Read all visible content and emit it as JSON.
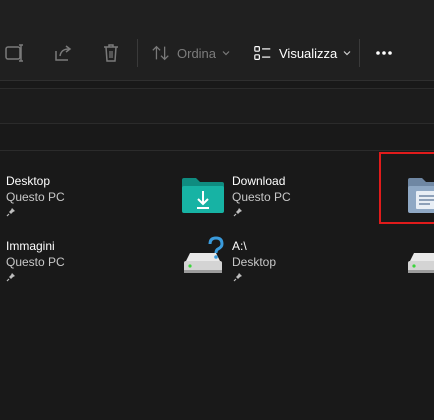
{
  "toolbar": {
    "rename_icon": "rename-icon",
    "share_icon": "share-icon",
    "delete_icon": "trash-icon",
    "sort_label": "Ordina",
    "view_label": "Visualizza",
    "more_icon": "more-icon"
  },
  "quick_access": [
    {
      "name": "Desktop",
      "location": "Questo PC",
      "icon": "desktop-folder-icon",
      "pinned": true
    },
    {
      "name": "Download",
      "location": "Questo PC",
      "icon": "download-folder-icon",
      "pinned": true
    },
    {
      "name": "",
      "location": "",
      "icon": "documents-folder-icon",
      "pinned": false
    },
    {
      "name": "Immagini",
      "location": "Questo PC",
      "icon": "pictures-folder-icon",
      "pinned": true
    },
    {
      "name": "A:\\",
      "location": "Desktop",
      "icon": "drive-unknown-icon",
      "pinned": true
    },
    {
      "name": "",
      "location": "",
      "icon": "drive-icon",
      "pinned": false
    }
  ],
  "colors": {
    "background": "#191919",
    "toolbar": "#202020",
    "highlight": "#e01b1b",
    "download_folder": "#17b3a4",
    "documents_folder": "#8fa8c4",
    "drive_light": "#3cd63c",
    "question_mark": "#3a9bdc"
  }
}
